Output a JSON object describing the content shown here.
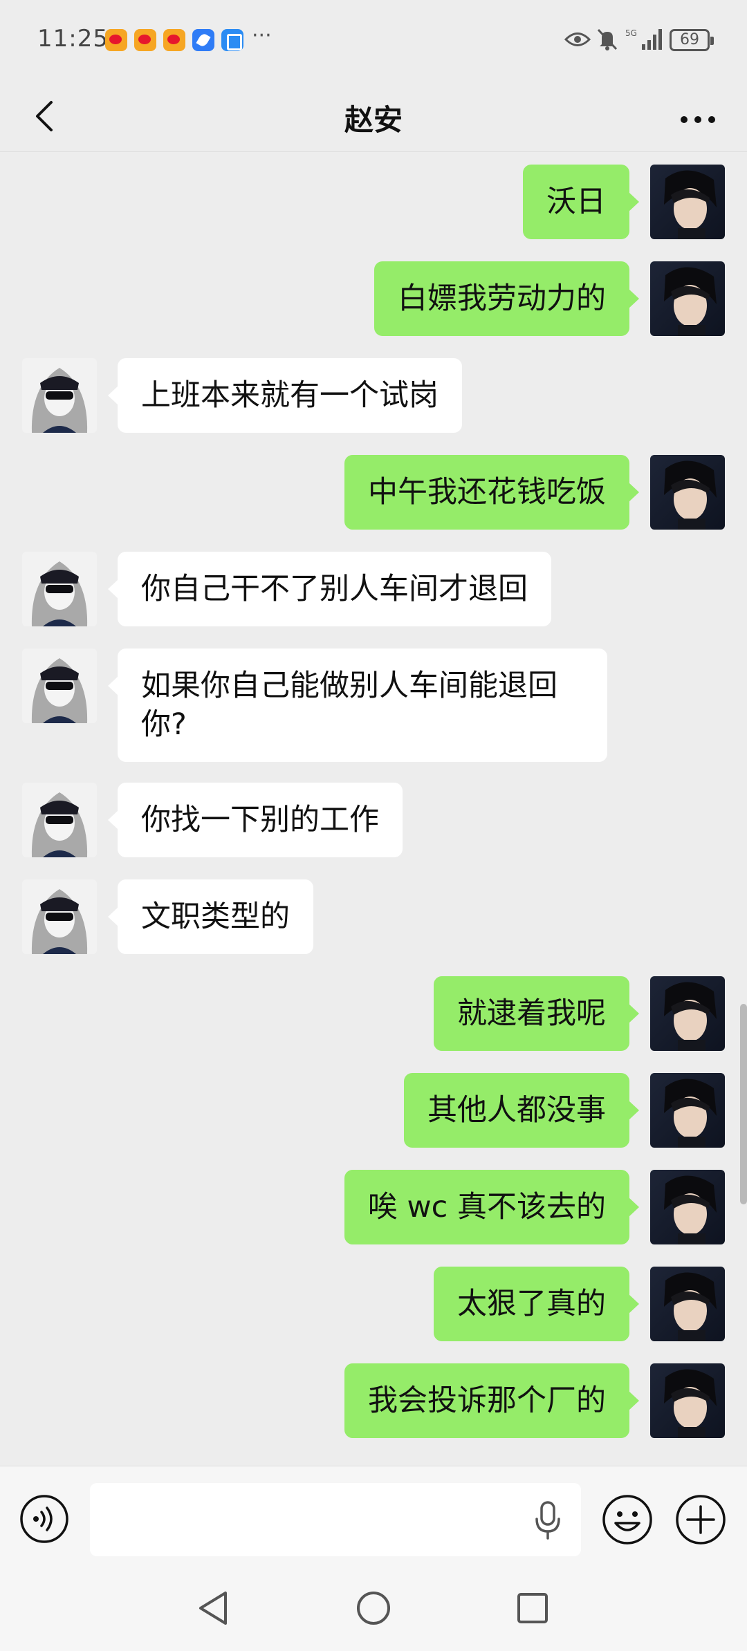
{
  "status_bar": {
    "time": "11:25",
    "more": "···",
    "battery": "69",
    "icons": [
      "weibo-icon",
      "weibo-icon",
      "weibo-icon",
      "browser-icon",
      "app-icon",
      "eye-icon",
      "mute-icon",
      "signal-5g-icon",
      "battery-icon"
    ]
  },
  "header": {
    "title": "赵安",
    "back_icon": "chevron-left-icon",
    "more_icon": "more-dots-icon"
  },
  "messages": [
    {
      "from": "me",
      "text": "沃日"
    },
    {
      "from": "me",
      "text": "白嫖我劳动力的"
    },
    {
      "from": "other",
      "text": "上班本来就有一个试岗"
    },
    {
      "from": "me",
      "text": "中午我还花钱吃饭"
    },
    {
      "from": "other",
      "text": "你自己干不了别人车间才退回"
    },
    {
      "from": "other",
      "text": "如果你自己能做别人车间能退回你?"
    },
    {
      "from": "other",
      "text": "你找一下别的工作"
    },
    {
      "from": "other",
      "text": "文职类型的"
    },
    {
      "from": "me",
      "text": "就逮着我呢"
    },
    {
      "from": "me",
      "text": "其他人都没事"
    },
    {
      "from": "me",
      "text": "唉 wc 真不该去的"
    },
    {
      "from": "me",
      "text": "太狠了真的"
    },
    {
      "from": "me",
      "text": "我会投诉那个厂的"
    }
  ],
  "input_bar": {
    "text_value": "",
    "voice_icon": "voice-icon",
    "mic_icon": "microphone-icon",
    "emoji_icon": "emoji-icon",
    "plus_icon": "plus-icon"
  },
  "colors": {
    "my_bubble": "#95ec69",
    "other_bubble": "#ffffff",
    "background": "#ededed"
  }
}
